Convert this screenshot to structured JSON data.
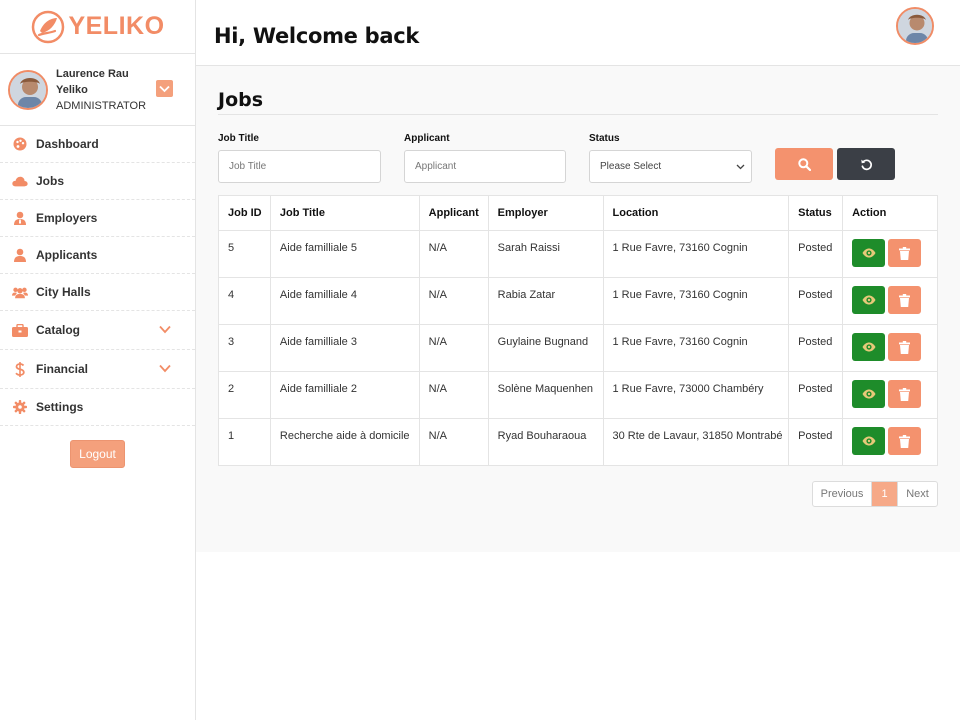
{
  "brand": {
    "name": "YELIKO"
  },
  "user": {
    "name": "Laurence Rau Yeliko",
    "role": "ADMINISTRATOR"
  },
  "sidebar": {
    "items": [
      {
        "label": "Dashboard",
        "icon": "palette-icon",
        "has_submenu": false
      },
      {
        "label": "Jobs",
        "icon": "cloud-icon",
        "has_submenu": false
      },
      {
        "label": "Employers",
        "icon": "user-tie-icon",
        "has_submenu": false
      },
      {
        "label": "Applicants",
        "icon": "user-icon",
        "has_submenu": false
      },
      {
        "label": "City Halls",
        "icon": "users-icon",
        "has_submenu": false
      },
      {
        "label": "Catalog",
        "icon": "briefcase-icon",
        "has_submenu": true
      },
      {
        "label": "Financial",
        "icon": "dollar-icon",
        "has_submenu": true
      },
      {
        "label": "Settings",
        "icon": "gear-icon",
        "has_submenu": false
      }
    ],
    "logout_label": "Logout"
  },
  "header": {
    "title": "Hi, Welcome back"
  },
  "page": {
    "title": "Jobs"
  },
  "filters": {
    "job_title": {
      "label": "Job Title",
      "placeholder": "Job Title"
    },
    "applicant": {
      "label": "Applicant",
      "placeholder": "Applicant"
    },
    "status": {
      "label": "Status",
      "value": "Please Select"
    }
  },
  "table": {
    "headers": [
      "Job ID",
      "Job Title",
      "Applicant",
      "Employer",
      "Location",
      "Status",
      "Action"
    ],
    "rows": [
      [
        "5",
        "Aide familliale 5",
        "N/A",
        "Sarah Raissi",
        "1 Rue Favre, 73160 Cognin",
        "Posted"
      ],
      [
        "4",
        "Aide familliale 4",
        "N/A",
        "Rabia Zatar",
        "1 Rue Favre, 73160 Cognin",
        "Posted"
      ],
      [
        "3",
        "Aide familliale 3",
        "N/A",
        "Guylaine Bugnand",
        "1 Rue Favre, 73160 Cognin",
        "Posted"
      ],
      [
        "2",
        "Aide familliale 2",
        "N/A",
        "Solène Maquenhen",
        "1 Rue Favre, 73000 Chambéry",
        "Posted"
      ],
      [
        "1",
        "Recherche aide à domicile",
        "N/A",
        "Ryad Bouharaoua",
        "30 Rte de Lavaur, 31850 Montrabé",
        "Posted"
      ]
    ]
  },
  "pagination": {
    "previous": "Previous",
    "current": "1",
    "next": "Next"
  },
  "colors": {
    "accent": "#f4926e",
    "view": "#1e8c2a",
    "dark": "#3b3f46"
  }
}
